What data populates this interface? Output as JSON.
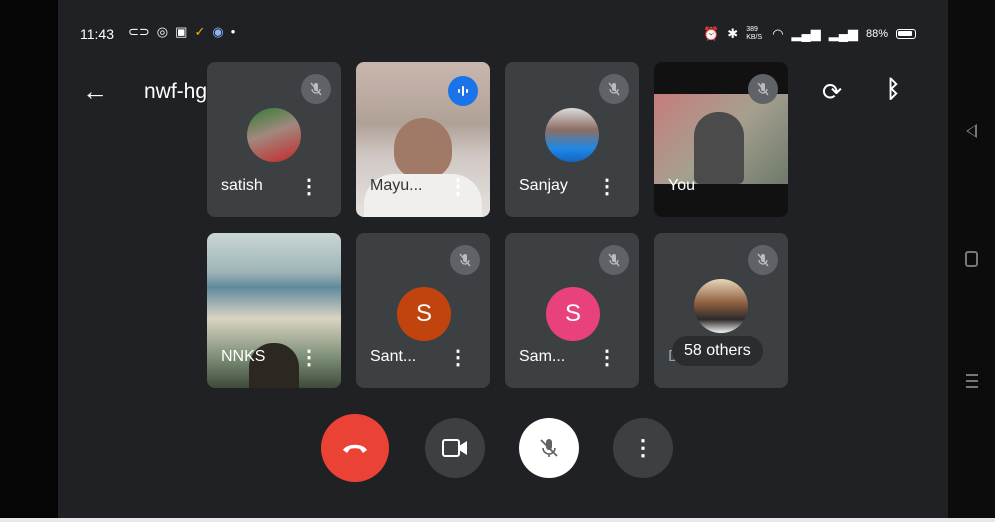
{
  "status_bar": {
    "time": "11:43",
    "network_speed": "389 KB/S",
    "battery": "88%"
  },
  "header": {
    "meeting_code": "nwf-hgnh-upp",
    "back_icon": "arrow-left-icon",
    "switch_camera_icon": "switch-camera-icon",
    "audio_output_icon": "bluetooth-icon"
  },
  "tiles": [
    {
      "name": "satish",
      "muted": true,
      "kind": "photo"
    },
    {
      "name": "Mayu...",
      "muted": false,
      "kind": "video"
    },
    {
      "name": "Sanjay",
      "muted": true,
      "kind": "photo"
    },
    {
      "name": "You",
      "muted": true,
      "kind": "video"
    },
    {
      "name": "NNKS",
      "muted": false,
      "kind": "video"
    },
    {
      "name": "Sant...",
      "muted": true,
      "kind": "letter",
      "letter": "S"
    },
    {
      "name": "Sam...",
      "muted": true,
      "kind": "letter",
      "letter": "S"
    },
    {
      "name": "Dr...",
      "muted": true,
      "kind": "photo"
    }
  ],
  "others_label": "58 others",
  "controls": {
    "end_call": "phone-hangup-icon",
    "camera": "video-camera-icon",
    "microphone": "mic-off-icon",
    "more": "more-vertical-icon"
  },
  "colors": {
    "background": "#202124",
    "tile": "#3c4043",
    "end_call": "#ea4335",
    "speaking": "#1a73e8",
    "avatar_sant": "#c1440e",
    "avatar_sam": "#e8417c"
  }
}
